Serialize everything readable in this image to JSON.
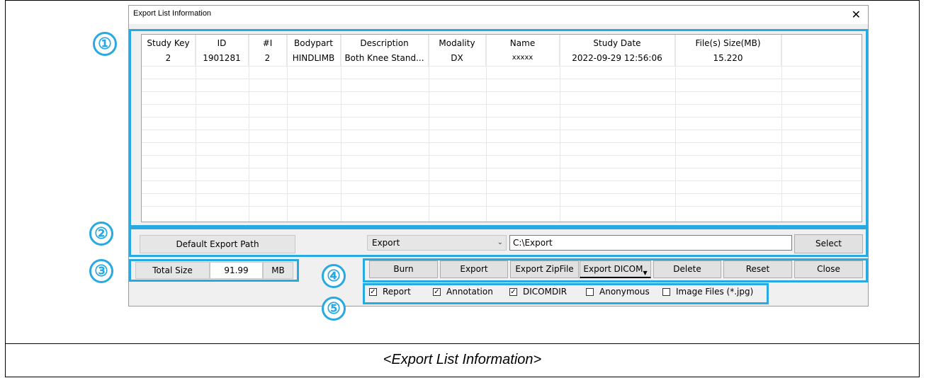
{
  "window": {
    "title": "Export List Information",
    "close_glyph": "✕"
  },
  "grid": {
    "columns": [
      "Study Key",
      "ID",
      "#I",
      "Bodypart",
      "Description",
      "Modality",
      "Name",
      "Study Date",
      "File(s) Size(MB)"
    ],
    "rows": [
      [
        "2",
        "1901281",
        "2",
        "HINDLIMB",
        "Both Knee Stand...",
        "DX",
        "xxxxx",
        "2022-09-29 12:56:06",
        "15.220"
      ]
    ]
  },
  "export_path": {
    "label": "Default Export Path",
    "type_selected": "Export",
    "path_value": "C:\\Export",
    "select_button": "Select"
  },
  "total": {
    "label": "Total Size",
    "value": "91.99",
    "unit": "MB"
  },
  "actions": {
    "burn": "Burn",
    "export": "Export",
    "export_zip": "Export ZipFile",
    "export_dicom": "Export DICOM",
    "delete": "Delete",
    "reset": "Reset",
    "close": "Close"
  },
  "options": [
    {
      "label": "Report",
      "checked": true
    },
    {
      "label": "Annotation",
      "checked": true
    },
    {
      "label": "DICOMDIR",
      "checked": true
    },
    {
      "label": "Anonymous",
      "checked": false
    },
    {
      "label": "Image Files (*.jpg)",
      "checked": false
    }
  ],
  "markers": [
    "①",
    "②",
    "③",
    "④",
    "⑤"
  ],
  "caption": "<Export List Information>",
  "colors": {
    "highlight": "#29a9e1"
  }
}
